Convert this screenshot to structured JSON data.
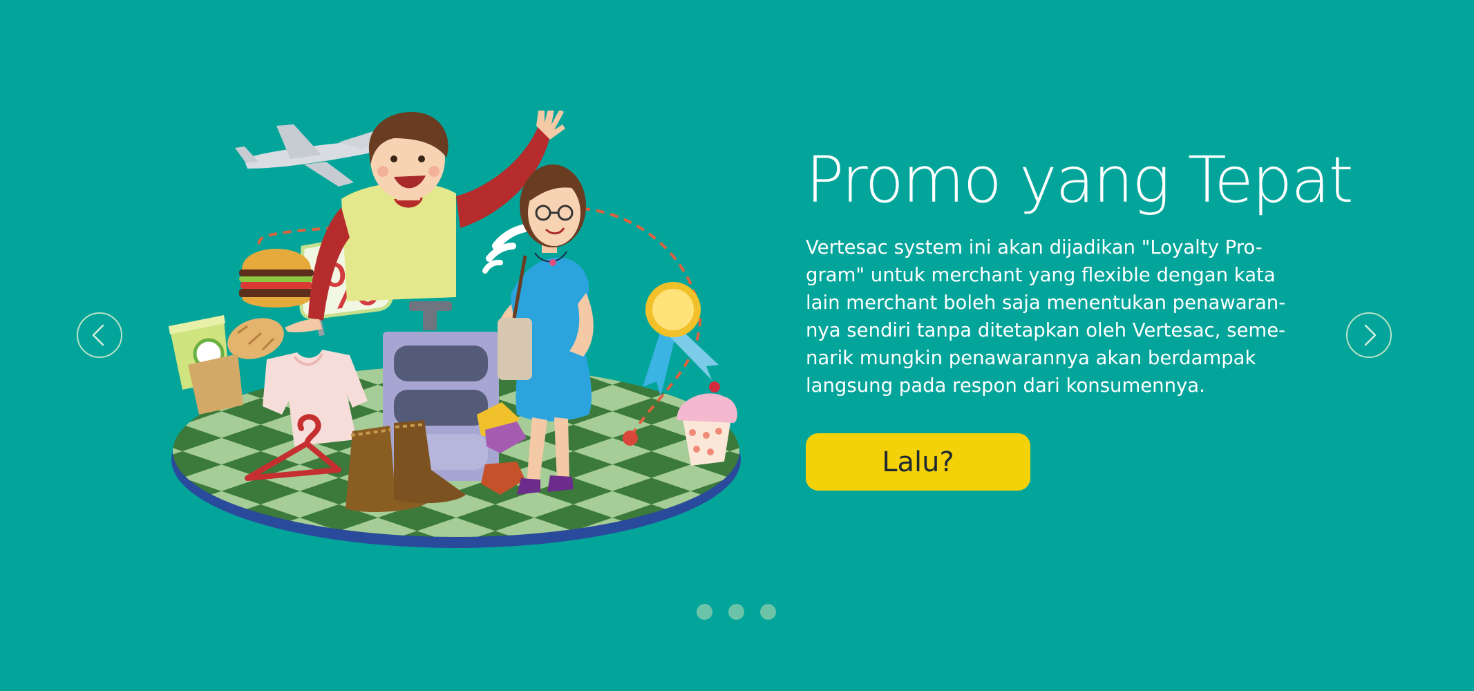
{
  "slider": {
    "title": "Promo yang Tepat",
    "description_lines": [
      "Vertesac system ini akan dijadikan \"Loyalty Pro-",
      "gram\" untuk merchant yang flexible dengan kata",
      "lain merchant boleh saja menentukan penawaran-",
      "nya sendiri tanpa ditetapkan oleh Vertesac, seme-",
      "narik mungkin penawarannya akan berdampak",
      "langsung pada respon dari konsumennya."
    ],
    "cta_label": "Lalu?",
    "active_slide": 1,
    "slide_count": 3
  },
  "illustration": {
    "percent_sign_text": "%"
  },
  "icons": {
    "prev": "chevron-left-icon",
    "next": "chevron-right-icon"
  },
  "colors": {
    "background": "#03a59b",
    "cta": "#f5d10a",
    "nav_border": "#b9e3c6",
    "dot": "#6cc4a8",
    "text": "#ffffff"
  }
}
